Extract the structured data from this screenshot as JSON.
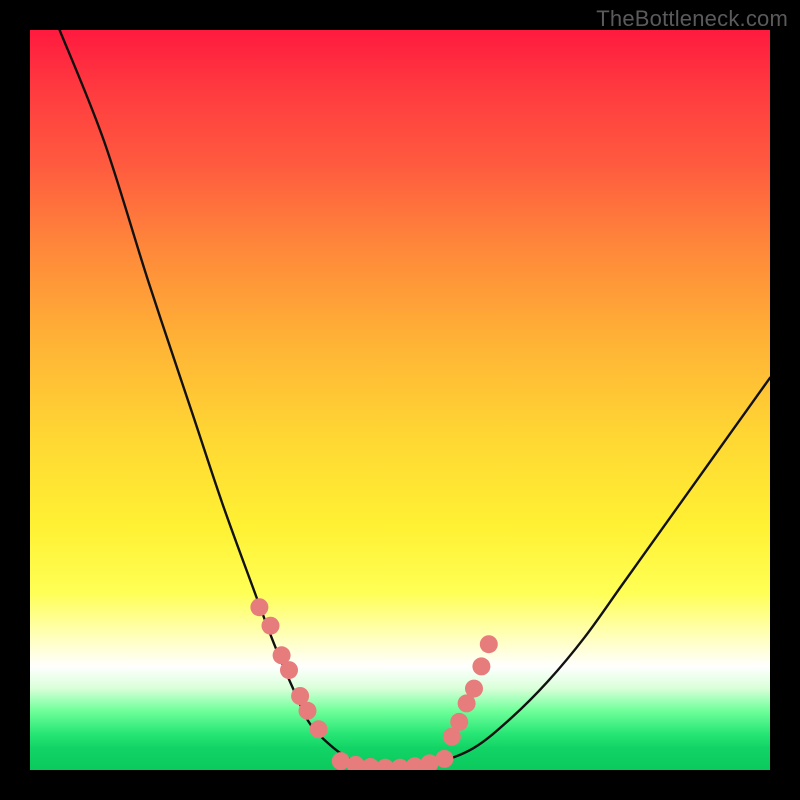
{
  "watermark": "TheBottleneck.com",
  "chart_data": {
    "type": "line",
    "title": "",
    "xlabel": "",
    "ylabel": "",
    "xlim": [
      0,
      100
    ],
    "ylim": [
      0,
      100
    ],
    "grid": false,
    "legend": false,
    "series": [
      {
        "name": "bottleneck-curve",
        "x": [
          4,
          10,
          16,
          22,
          26,
          30,
          33,
          36,
          38,
          41,
          44,
          47,
          50,
          55,
          60,
          65,
          70,
          75,
          80,
          85,
          90,
          95,
          100
        ],
        "values": [
          100,
          85,
          66,
          48,
          36,
          25,
          17,
          10,
          6,
          3,
          1,
          0,
          0,
          1,
          3,
          7,
          12,
          18,
          25,
          32,
          39,
          46,
          53
        ]
      }
    ],
    "marker_clusters": [
      {
        "name": "left-cluster",
        "x": [
          31,
          32.5,
          34,
          35,
          36.5,
          37.5,
          39
        ],
        "values": [
          22,
          19.5,
          15.5,
          13.5,
          10,
          8,
          5.5
        ]
      },
      {
        "name": "bottom-cluster",
        "x": [
          42,
          44,
          46,
          48,
          50,
          52,
          54,
          56
        ],
        "values": [
          1.2,
          0.7,
          0.4,
          0.3,
          0.3,
          0.5,
          0.9,
          1.5
        ]
      },
      {
        "name": "right-cluster",
        "x": [
          57,
          58,
          59,
          60,
          61,
          62
        ],
        "values": [
          4.5,
          6.5,
          9,
          11,
          14,
          17
        ]
      }
    ],
    "marker_color": "#e77c7c",
    "marker_radius_px": 9
  }
}
